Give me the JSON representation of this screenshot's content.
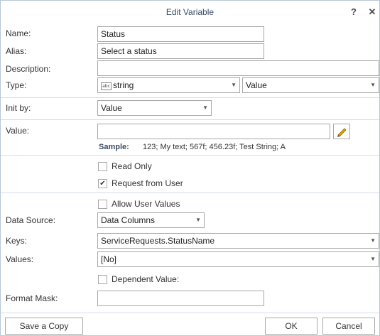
{
  "dialog": {
    "title": "Edit Variable",
    "help_label": "?",
    "close_label": "✕"
  },
  "fields": {
    "name_label": "Name:",
    "name_value": "Status",
    "alias_label": "Alias:",
    "alias_value": "Select a status",
    "description_label": "Description:",
    "description_value": "",
    "type_label": "Type:",
    "type_value": "string",
    "type_icon": "abc-icon",
    "type_mode_value": "Value",
    "init_by_label": "Init by:",
    "init_by_value": "Value",
    "value_label": "Value:",
    "value_value": "",
    "sample_label": "Sample:",
    "sample_text": "123; My text; 567f; 456.23f; Test String; A",
    "read_only_label": "Read Only",
    "read_only_checked": false,
    "request_from_user_label": "Request from User",
    "request_from_user_checked": true,
    "allow_user_values_label": "Allow User Values",
    "allow_user_values_checked": false,
    "data_source_label": "Data Source:",
    "data_source_value": "Data Columns",
    "keys_label": "Keys:",
    "keys_value": "ServiceRequests.StatusName",
    "values_label": "Values:",
    "values_value": "[No]",
    "dependent_value_label": "Dependent Value:",
    "dependent_value_checked": false,
    "format_mask_label": "Format Mask:",
    "format_mask_value": ""
  },
  "footer": {
    "save_copy_label": "Save a Copy",
    "ok_label": "OK",
    "cancel_label": "Cancel"
  },
  "colors": {
    "border": "#b8c7d6",
    "pencil": "#e0a800"
  }
}
